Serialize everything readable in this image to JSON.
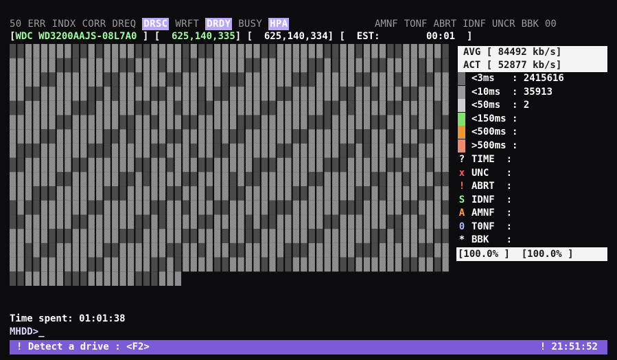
{
  "flags": [
    {
      "label": "50",
      "on": false
    },
    {
      "label": "ERR",
      "on": false
    },
    {
      "label": "INDX",
      "on": false
    },
    {
      "label": "CORR",
      "on": false
    },
    {
      "label": "DREQ",
      "on": false
    },
    {
      "label": "DRSC",
      "on": true
    },
    {
      "label": "WRFT",
      "on": false
    },
    {
      "label": "DRDY",
      "on": true
    },
    {
      "label": "BUSY",
      "on": false
    },
    {
      "label": "HPA",
      "on": true
    }
  ],
  "flags_right": [
    "AMNF",
    "TONF",
    "ABRT",
    "IDNF",
    "UNCR",
    "BBK",
    "00"
  ],
  "drive": {
    "open": "[",
    "model": "WDC WD3200AAJS-08L7A0",
    "lba_total": "625,140,335",
    "lba_current": "625,140,334",
    "est_label": "EST:",
    "est_time": "00:01"
  },
  "speed": {
    "avg": "AVG [ 84492 kb/s]",
    "act": "ACT [ 52877 kb/s]"
  },
  "latency": [
    {
      "label": "<3ms",
      "sep": ":",
      "count": "2415616",
      "color": "#6e6e6e"
    },
    {
      "label": "<10ms",
      "sep": ":",
      "count": "35913",
      "color": "#9a9a9a"
    },
    {
      "label": "<50ms",
      "sep": ":",
      "count": "2",
      "color": "#d0d0d0"
    },
    {
      "label": "<150ms",
      "sep": ":",
      "count": "",
      "color": "#7fe36a"
    },
    {
      "label": "<500ms",
      "sep": ":",
      "count": "",
      "color": "#f0962a"
    },
    {
      "label": ">500ms",
      "sep": ":",
      "count": "",
      "color": "#f08a6a"
    }
  ],
  "errors": [
    {
      "icon": "?",
      "label": "TIME",
      "count": "",
      "color": "#ffffff",
      "icon_name": "question-icon"
    },
    {
      "icon": "x",
      "label": "UNC",
      "count": "",
      "color": "#ff5a5a",
      "icon_name": "cross-icon"
    },
    {
      "icon": "!",
      "label": "ABRT",
      "count": "",
      "color": "#ff6a6a",
      "icon_name": "exclamation-icon"
    },
    {
      "icon": "S",
      "label": "IDNF",
      "count": "",
      "color": "#8cff8c",
      "icon_name": "s-icon"
    },
    {
      "icon": "A",
      "label": "AMNF",
      "count": "",
      "color": "#ffa040",
      "icon_name": "a-icon"
    },
    {
      "icon": "0",
      "label": "T0NF",
      "count": "",
      "color": "#a8b8ff",
      "icon_name": "zero-icon"
    },
    {
      "icon": "*",
      "label": "BBK",
      "count": "",
      "color": "#ffffff",
      "icon_name": "asterisk-icon"
    }
  ],
  "progress": "[100.0% ]  [100.0% ]",
  "time_spent": "Time spent: 01:01:38",
  "prompt": "MHDD>",
  "status": {
    "left": "! Detect a drive : <F2>",
    "right": "! 21:51:52",
    "color": "#7c5bd8"
  }
}
